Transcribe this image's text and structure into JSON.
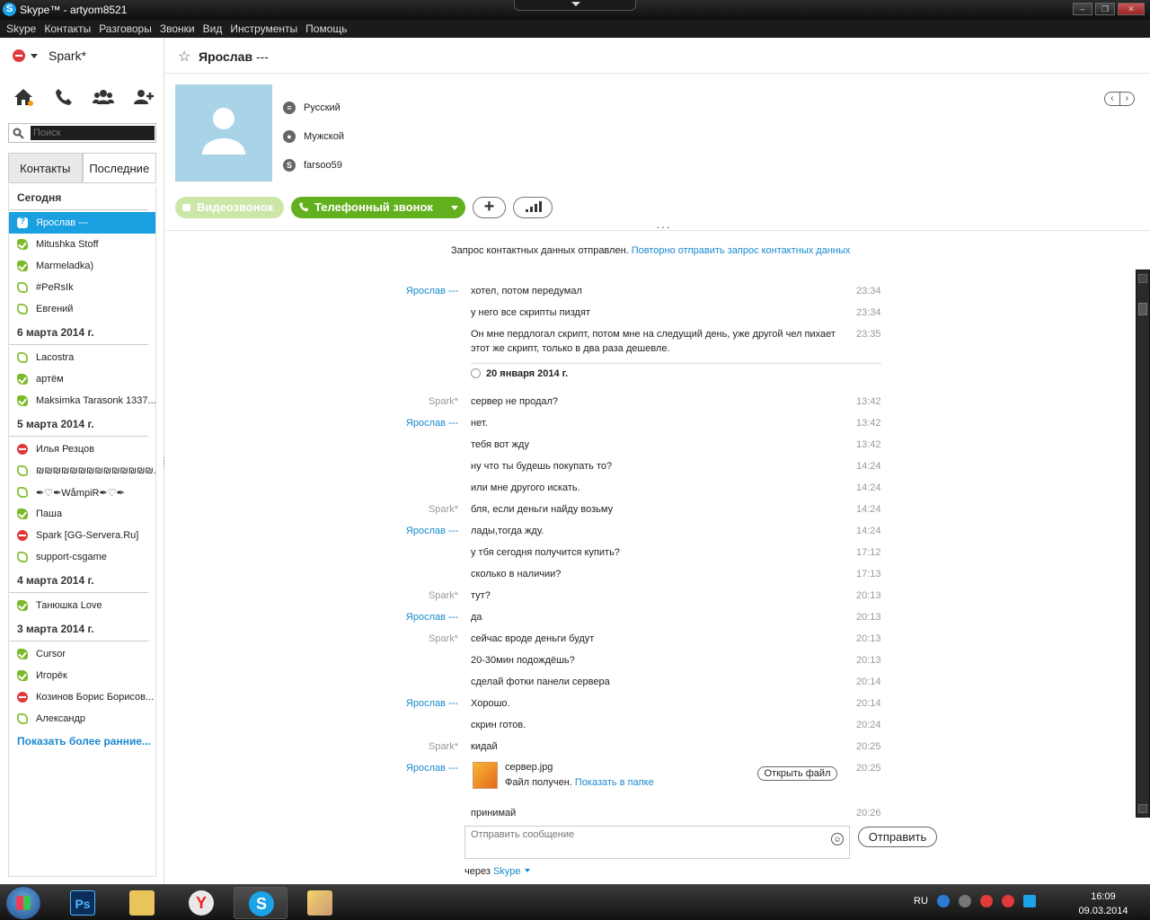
{
  "window": {
    "title": "Skype™ - artyom8521"
  },
  "menu": [
    "Skype",
    "Контакты",
    "Разговоры",
    "Звонки",
    "Вид",
    "Инструменты",
    "Помощь"
  ],
  "sidebar": {
    "profile_name": "Spark*",
    "search_placeholder": "Поиск",
    "tabs": {
      "contacts": "Контакты",
      "recent": "Последние"
    },
    "groups": [
      {
        "label": "Сегодня",
        "items": [
          {
            "name": "Ярослав ---",
            "status": "selected"
          },
          {
            "name": "Mitushka Stoff",
            "status": "online"
          },
          {
            "name": "Marmeladka)",
            "status": "online"
          },
          {
            "name": "#PeRsIk",
            "status": "offline"
          },
          {
            "name": "Евгений",
            "status": "offline"
          }
        ]
      },
      {
        "label": "6 марта 2014 г.",
        "items": [
          {
            "name": "Lacostra",
            "status": "offline"
          },
          {
            "name": "артём",
            "status": "online"
          },
          {
            "name": "Maksimka Tarasonk 1337...",
            "status": "online"
          }
        ]
      },
      {
        "label": "5 марта 2014 г.",
        "items": [
          {
            "name": "Илья Резцов",
            "status": "dnd"
          },
          {
            "name": "₪₪₪₪₪₪₪₪₪₪₪₪₪₪...",
            "status": "offline"
          },
          {
            "name": "✒♡✒WåmpiR✒♡✒",
            "status": "offline"
          },
          {
            "name": "Паша",
            "status": "online"
          },
          {
            "name": "Spark [GG-Servera.Ru]",
            "status": "dnd"
          },
          {
            "name": "support-csgame",
            "status": "offline"
          }
        ]
      },
      {
        "label": "4 марта 2014 г.",
        "items": [
          {
            "name": "Танюшка Love",
            "status": "online"
          }
        ]
      },
      {
        "label": "3 марта 2014 г.",
        "items": [
          {
            "name": "Cursor",
            "status": "online"
          },
          {
            "name": "Игорёк",
            "status": "online"
          },
          {
            "name": "Козинов Борис Борисов...",
            "status": "dnd"
          },
          {
            "name": "Александр",
            "status": "offline"
          }
        ]
      }
    ],
    "show_more": "Показать более ранние..."
  },
  "contact": {
    "name": "Ярослав",
    "name_suffix": "---",
    "language": "Русский",
    "gender": "Мужской",
    "skype_id": "farsoo59"
  },
  "actions": {
    "video": "Видеозвонок",
    "phone": "Телефонный звонок"
  },
  "notice": {
    "text": "Запрос контактных данных отправлен.",
    "link": "Повторно отправить запрос контактных данных"
  },
  "messages": [
    {
      "who": "Ярослав ---",
      "side": "y",
      "text": "хотел, потом передумал",
      "time": "23:34"
    },
    {
      "who": "",
      "side": "y",
      "text": "у него все скрипты пиздят",
      "time": "23:34"
    },
    {
      "who": "",
      "side": "y",
      "text": "Он мне пердлогал скрипт, потом мне на следущий день, уже другой чел пихает",
      "text2": "этот же скрипт, только в два раза дешевле.",
      "time": "23:35"
    },
    {
      "who": "Spark*",
      "side": "s",
      "text": "сервер не продал?",
      "time": "13:42"
    },
    {
      "who": "Ярослав ---",
      "side": "y",
      "text": "нет.",
      "time": "13:42"
    },
    {
      "who": "",
      "side": "y",
      "text": "тебя вот жду",
      "time": "13:42"
    },
    {
      "who": "",
      "side": "y",
      "text": "ну что ты будешь покупать то?",
      "time": "14:24"
    },
    {
      "who": "",
      "side": "y",
      "text": "или мне другого искать.",
      "time": "14:24"
    },
    {
      "who": "Spark*",
      "side": "s",
      "text": "бля, если деньги найду возьму",
      "time": "14:24"
    },
    {
      "who": "Ярослав ---",
      "side": "y",
      "text": "лады,тогда жду.",
      "time": "14:24"
    },
    {
      "who": "",
      "side": "y",
      "text": "у тбя сегодня получится купить?",
      "time": "17:12"
    },
    {
      "who": "",
      "side": "y",
      "text": "сколько в наличии?",
      "time": "17:13"
    },
    {
      "who": "Spark*",
      "side": "s",
      "text": "тут?",
      "time": "20:13"
    },
    {
      "who": "Ярослав ---",
      "side": "y",
      "text": "да",
      "time": "20:13"
    },
    {
      "who": "Spark*",
      "side": "s",
      "text": "сейчас вроде деньги будут",
      "time": "20:13"
    },
    {
      "who": "",
      "side": "s",
      "text": "20-30мин подождёшь?",
      "time": "20:13"
    },
    {
      "who": "",
      "side": "s",
      "text": "сделай фотки панели сервера",
      "time": "20:14"
    },
    {
      "who": "Ярослав ---",
      "side": "y",
      "text": "Хорошо.",
      "time": "20:14"
    },
    {
      "who": "",
      "side": "y",
      "text": "скрин готов.",
      "time": "20:24"
    },
    {
      "who": "Spark*",
      "side": "s",
      "text": "кидай",
      "time": "20:25"
    },
    {
      "who": "Ярослав ---",
      "side": "y",
      "text": "",
      "time": "20:25"
    },
    {
      "who": "",
      "side": "y",
      "text": "принимай",
      "time": "20:26"
    }
  ],
  "date_separator": "20 января 2014 г.",
  "file": {
    "name": "сервер.jpg",
    "status": "Файл получен.",
    "show_link": "Показать в папке",
    "open": "Открыть файл"
  },
  "compose": {
    "placeholder": "Отправить сообщение",
    "send": "Отправить",
    "via": "через",
    "via_link": "Skype"
  },
  "taskbar": {
    "lang": "RU",
    "time": "16:09",
    "date": "09.03.2014"
  }
}
